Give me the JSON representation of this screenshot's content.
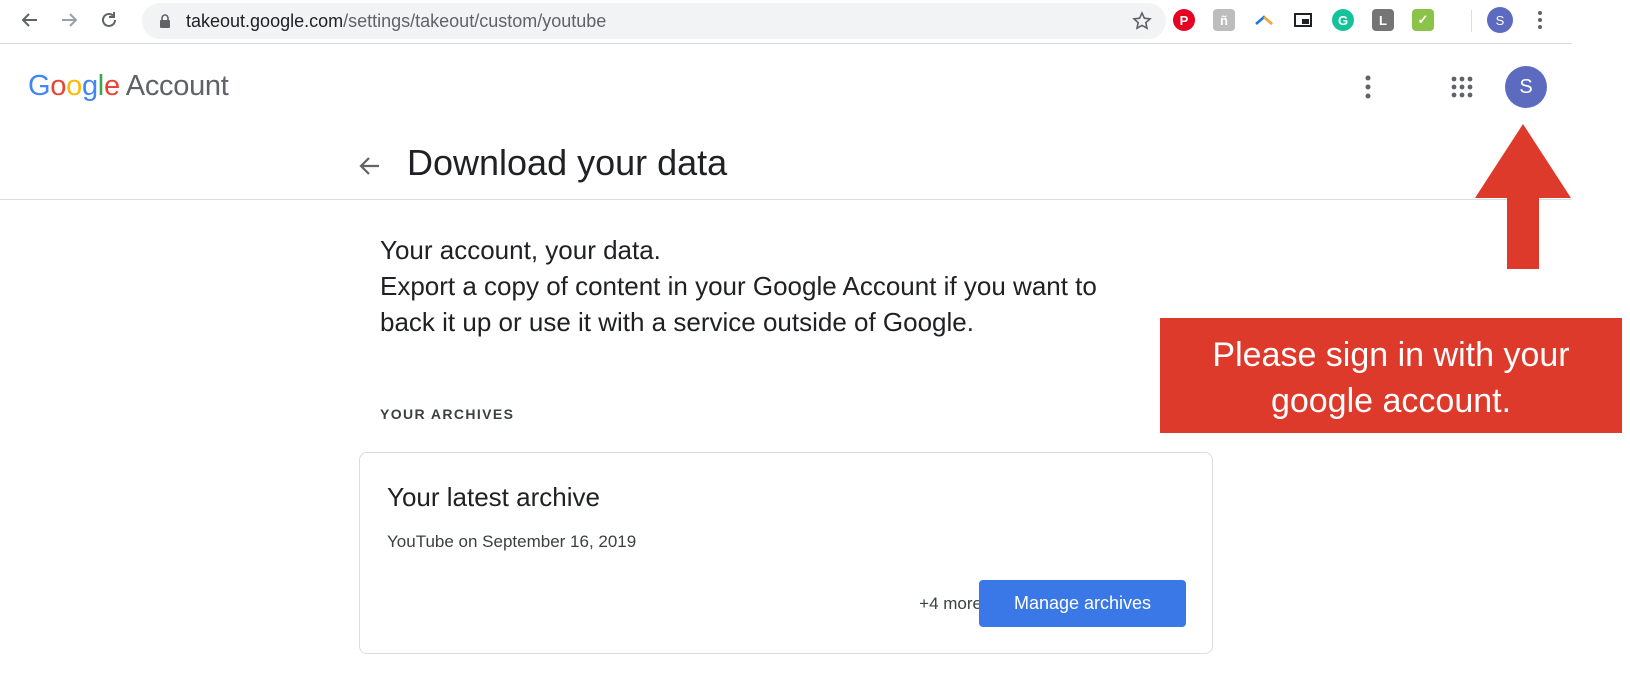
{
  "browser": {
    "url_host": "takeout.google.com",
    "url_path": "/settings/takeout/custom/youtube",
    "profile_initial": "S",
    "icons": [
      "back-icon",
      "forward-icon",
      "reload-icon",
      "lock-icon",
      "star-icon",
      "pinterest-icon",
      "extension-icon",
      "extension-icon",
      "picture-in-picture-icon",
      "grammarly-icon",
      "extension-icon",
      "extension-icon",
      "more-vert-icon"
    ]
  },
  "header": {
    "logo_letters": [
      "G",
      "o",
      "o",
      "g",
      "l",
      "e"
    ],
    "logo_suffix": "Account",
    "avatar_initial": "S",
    "icons": [
      "more-vert-icon",
      "apps-grid-icon"
    ]
  },
  "page": {
    "title": "Download your data"
  },
  "intro": {
    "line1": "Your account, your data.",
    "line2": "Export a copy of content in your Google Account if you want to",
    "line3": "back it up or use it with a service outside of Google."
  },
  "archives": {
    "section_label": "YOUR ARCHIVES",
    "card_title": "Your latest archive",
    "card_subtitle": "YouTube on September 16, 2019",
    "more_label": "+4 more",
    "manage_label": "Manage archives"
  },
  "annotation": {
    "line1": "Please sign in with your",
    "line2": "google account.",
    "color": "#de3a2b"
  },
  "colors": {
    "google_blue": "#4285f4",
    "google_red": "#ea4335",
    "google_yellow": "#fbbc05",
    "google_green": "#34a853",
    "button_blue": "#3b78e7",
    "avatar_purple": "#5c6bc0"
  }
}
